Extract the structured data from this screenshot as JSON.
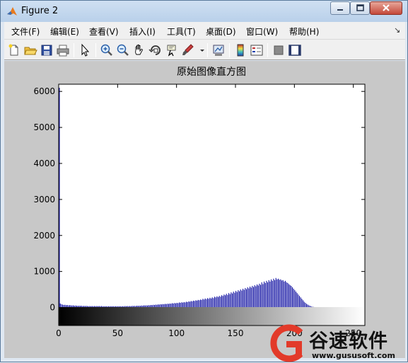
{
  "window": {
    "title": "Figure 2"
  },
  "menu": [
    "文件(F)",
    "编辑(E)",
    "查看(V)",
    "插入(I)",
    "工具(T)",
    "桌面(D)",
    "窗口(W)",
    "帮助(H)"
  ],
  "toolbar": [
    "new-figure-icon",
    "open-file-icon",
    "save-icon",
    "print-icon",
    "pointer-icon",
    "zoom-in-icon",
    "zoom-out-icon",
    "pan-hand-icon",
    "rotate-3d-icon",
    "data-cursor-icon",
    "brush-icon",
    "link-plot-icon",
    "colorbar-icon",
    "legend-icon",
    "hide-plot-tools-icon",
    "show-plot-tools-icon"
  ],
  "chart_data": {
    "type": "bar",
    "title": "原始图像直方图",
    "xlabel": "",
    "ylabel": "",
    "ylim": [
      -500,
      6200
    ],
    "xlim": [
      0,
      255
    ],
    "yticks": [
      0,
      1000,
      2000,
      3000,
      4000,
      5000,
      6000
    ],
    "xticks": [
      0,
      50,
      100,
      150,
      200,
      250
    ],
    "bar_color": "#1a1aa6",
    "colorbar": "grayscale gradient 0 (black) to 255 (white)",
    "x_start": 0,
    "values": [
      6100,
      110,
      90,
      80,
      70,
      75,
      65,
      70,
      60,
      65,
      60,
      55,
      60,
      50,
      55,
      50,
      45,
      50,
      45,
      50,
      40,
      45,
      40,
      45,
      40,
      35,
      40,
      35,
      40,
      35,
      40,
      35,
      40,
      35,
      40,
      35,
      40,
      30,
      35,
      30,
      35,
      30,
      35,
      30,
      35,
      30,
      35,
      30,
      35,
      30,
      35,
      30,
      35,
      30,
      35,
      30,
      40,
      35,
      40,
      35,
      40,
      35,
      45,
      40,
      45,
      40,
      50,
      45,
      50,
      45,
      55,
      50,
      60,
      55,
      60,
      55,
      65,
      60,
      70,
      65,
      75,
      70,
      80,
      75,
      85,
      80,
      90,
      85,
      95,
      90,
      100,
      95,
      105,
      100,
      110,
      105,
      120,
      110,
      125,
      115,
      130,
      120,
      140,
      130,
      145,
      135,
      150,
      140,
      160,
      150,
      170,
      160,
      180,
      170,
      190,
      180,
      200,
      190,
      210,
      200,
      220,
      210,
      240,
      220,
      250,
      230,
      260,
      240,
      270,
      250,
      280,
      260,
      300,
      280,
      310,
      290,
      320,
      300,
      340,
      320,
      360,
      340,
      380,
      350,
      400,
      370,
      420,
      390,
      440,
      410,
      460,
      430,
      480,
      450,
      500,
      470,
      520,
      490,
      540,
      510,
      560,
      530,
      580,
      550,
      600,
      570,
      620,
      590,
      640,
      610,
      660,
      630,
      700,
      650,
      720,
      680,
      740,
      700,
      760,
      720,
      780,
      740,
      800,
      760,
      820,
      780,
      800,
      770,
      780,
      750,
      760,
      720,
      740,
      700,
      680,
      650,
      620,
      600,
      560,
      520,
      480,
      440,
      400,
      360,
      320,
      280,
      240,
      200,
      160,
      130,
      100,
      80,
      60,
      45,
      30,
      20,
      15,
      10,
      8,
      6,
      5,
      4,
      3,
      3,
      2,
      2,
      2,
      1,
      1,
      1,
      1,
      1,
      0,
      0,
      0,
      0,
      0,
      0,
      0,
      0,
      0,
      0,
      0,
      0,
      0,
      0,
      0,
      0,
      0,
      0,
      0,
      0,
      0,
      0,
      0,
      0,
      0,
      0,
      0,
      0,
      0,
      0
    ]
  },
  "watermark": {
    "name": "谷速软件",
    "url": "www.gususoft.com"
  }
}
